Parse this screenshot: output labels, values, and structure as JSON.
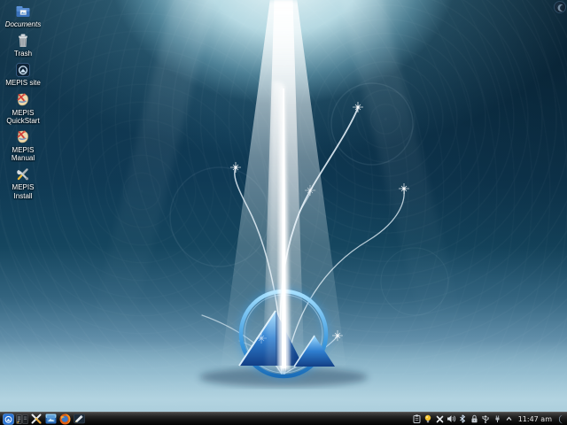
{
  "desktop": {
    "icons": [
      {
        "label": "Documents"
      },
      {
        "label": "Trash"
      },
      {
        "label": "MEPIS site"
      },
      {
        "label": "MEPIS QuickStart"
      },
      {
        "label": "MEPIS Manual"
      },
      {
        "label": "MEPIS Install"
      }
    ]
  },
  "taskbar": {
    "clock": "11:47 am",
    "launcher_icons": [
      "mepis-menu",
      "desktop-pager",
      "utility-x",
      "file-manager",
      "firefox",
      "mail-composer"
    ],
    "tray_icons": [
      "clipboard",
      "power-bulb",
      "input-x",
      "volume",
      "bluetooth",
      "wallet-lock",
      "usb-device",
      "network-plug",
      "tray-expander"
    ]
  },
  "colors": {
    "panel_bg": "#1a1a1a",
    "accent_blue": "#2f7fe0",
    "water_deep": "#0e3750",
    "water_light": "#cdeef5",
    "sand": "#a8cad8",
    "emblem_glow": "#4db8f0"
  }
}
